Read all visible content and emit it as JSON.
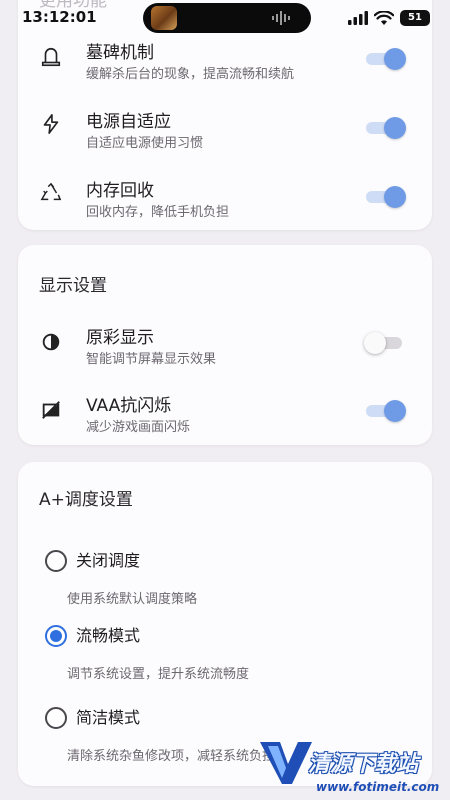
{
  "status_bar": {
    "time": "13:12:01",
    "battery": "51"
  },
  "card1": {
    "title_partial": "更用功能",
    "items": [
      {
        "title": "墓碑机制",
        "desc": "缓解杀后台的现象，提高流畅和续航",
        "enabled": true
      },
      {
        "title": "电源自适应",
        "desc": "自适应电源使用习惯",
        "enabled": true
      },
      {
        "title": "内存回收",
        "desc": "回收内存，降低手机负担",
        "enabled": true
      }
    ]
  },
  "display_settings": {
    "title": "显示设置",
    "items": [
      {
        "title": "原彩显示",
        "desc": "智能调节屏幕显示效果",
        "enabled": false
      },
      {
        "title": "VAA抗闪烁",
        "desc": "减少游戏画面闪烁",
        "enabled": true
      }
    ]
  },
  "scheduling": {
    "title": "A+调度设置",
    "options": [
      {
        "label": "关闭调度",
        "desc": "使用系统默认调度策略",
        "selected": false
      },
      {
        "label": "流畅模式",
        "desc": "调节系统设置，提升系统流畅度",
        "selected": true
      },
      {
        "label": "简洁模式",
        "desc": "清除系统杂鱼修改项，减轻系统负担",
        "selected": false
      }
    ]
  },
  "watermark": {
    "brand": "清源下载站",
    "url": "www.fotimeit.com"
  },
  "colors": {
    "accent": "#2f6fe0",
    "toggle_on": "#6f9be6",
    "background": "#f1eef3",
    "card": "#fcfbfd"
  },
  "icons": {
    "tombstone": "tombstone-icon",
    "power": "lightning-icon",
    "memory": "recycle-icon",
    "color_display": "contrast-icon",
    "anti_flicker": "flicker-off-icon"
  }
}
